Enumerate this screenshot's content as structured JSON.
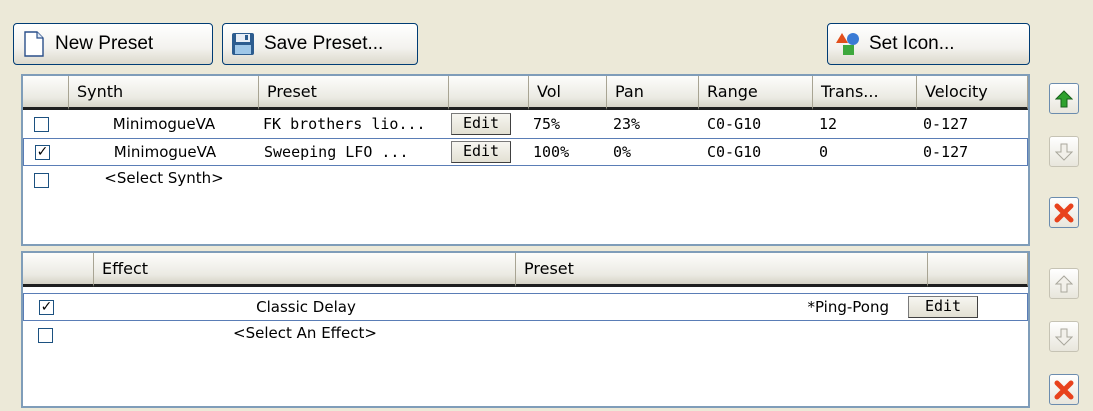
{
  "toolbar": {
    "new_preset": "New Preset",
    "save_preset": "Save Preset...",
    "set_icon": "Set Icon..."
  },
  "synth_table": {
    "headers": [
      "Synth",
      "Preset",
      "Vol",
      "Pan",
      "Range",
      "Trans...",
      "Velocity"
    ],
    "rows": [
      {
        "checked": false,
        "synth": "MinimogueVA",
        "preset": "FK brothers lio...",
        "edit": "Edit",
        "vol": "75%",
        "pan": "23%",
        "range": "C0-G10",
        "trans": "12",
        "velocity": "0-127"
      },
      {
        "checked": true,
        "synth": "MinimogueVA",
        "preset": "Sweeping LFO ...",
        "edit": "Edit",
        "vol": "100%",
        "pan": "0%",
        "range": "C0-G10",
        "trans": "0",
        "velocity": "0-127"
      }
    ],
    "placeholder": "<Select Synth>"
  },
  "effect_table": {
    "headers": [
      "Effect",
      "Preset"
    ],
    "rows": [
      {
        "checked": true,
        "effect": "Classic Delay",
        "preset": "*Ping-Pong",
        "edit": "Edit"
      }
    ],
    "placeholder": "<Select An Effect>"
  },
  "icons": {
    "new_preset": "document-icon",
    "save_preset": "floppy-disk-icon",
    "set_icon": "shapes-icon",
    "move_up": "arrow-up-icon",
    "move_down": "arrow-down-icon",
    "delete": "delete-x-icon"
  },
  "colors": {
    "background": "#ece9d8",
    "accent_green": "#2ea22e",
    "delete_red": "#e8421c",
    "selection_border": "#5a7db6"
  }
}
